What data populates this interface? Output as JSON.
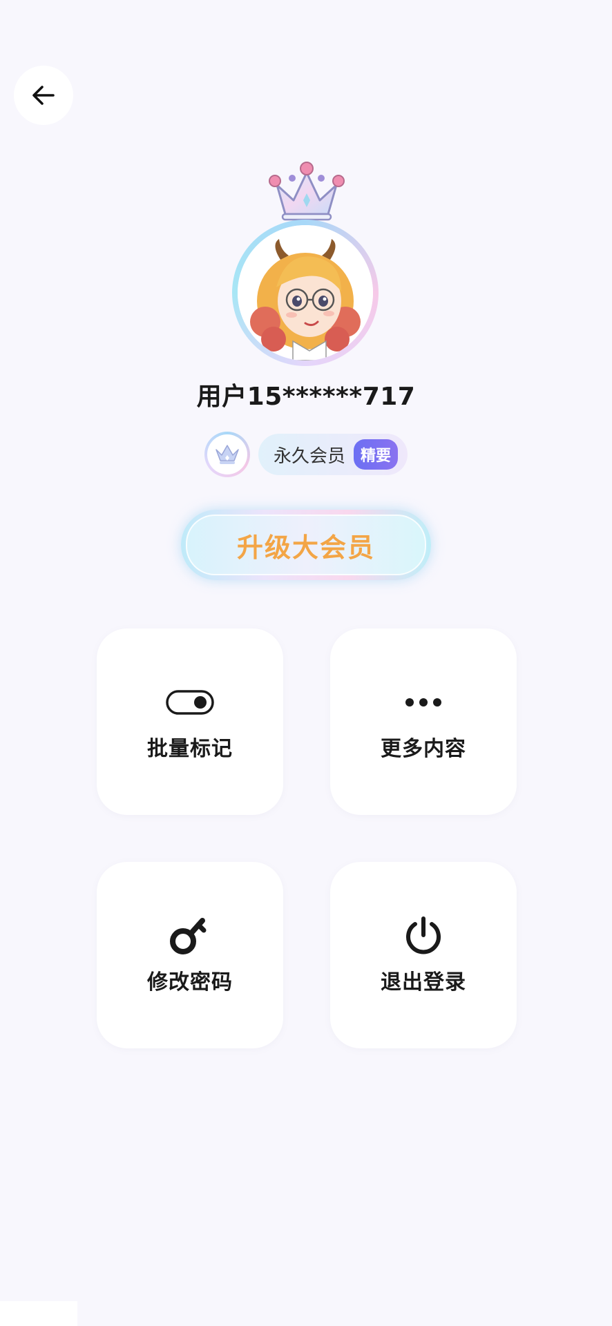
{
  "header": {
    "back_icon": "arrow-left-icon"
  },
  "profile": {
    "username": "用户15******717",
    "membership": "永久会员",
    "membership_badge": "精要",
    "upgrade_label": "升级大会员"
  },
  "actions": [
    {
      "label": "批量标记",
      "icon": "toggle-icon"
    },
    {
      "label": "更多内容",
      "icon": "more-dots-icon"
    },
    {
      "label": "修改密码",
      "icon": "key-icon"
    },
    {
      "label": "退出登录",
      "icon": "power-icon"
    }
  ],
  "colors": {
    "background": "#f8f7fd",
    "upgrade_text": "#f3a546",
    "badge": "#6b6ff3"
  }
}
